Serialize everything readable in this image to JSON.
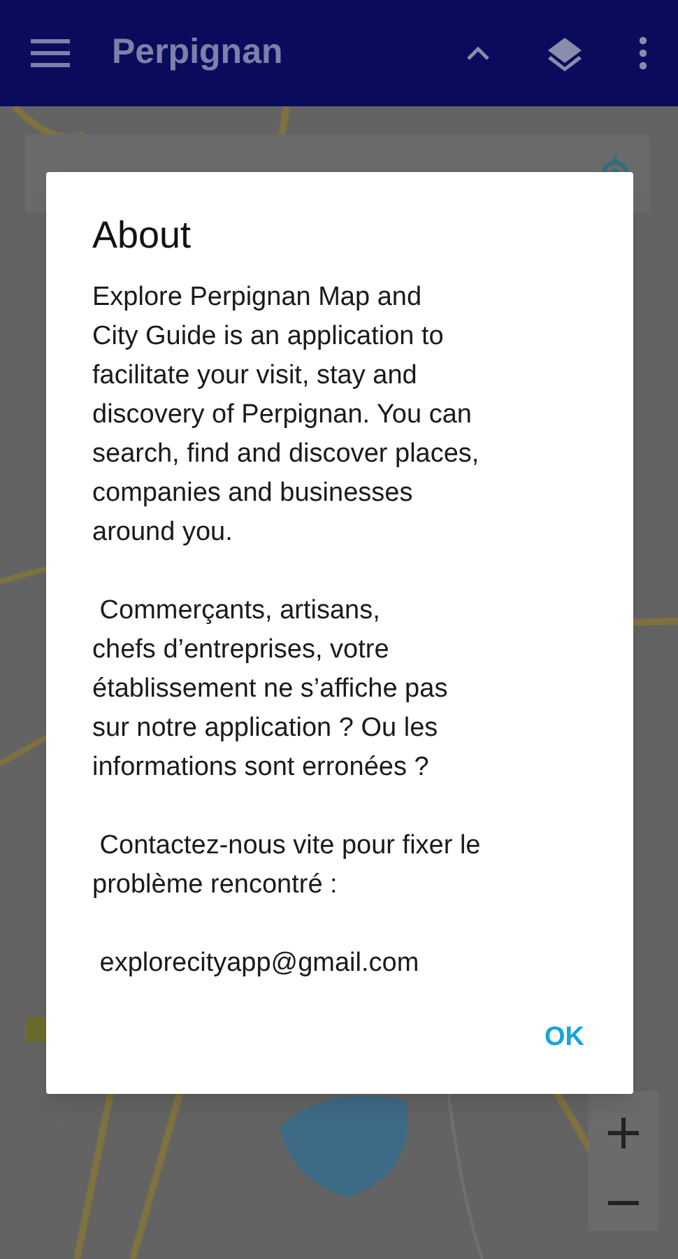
{
  "app_bar": {
    "title": "Perpignan"
  },
  "dialog": {
    "title": "About",
    "paragraphs": [
      "Explore Perpignan Map and\nCity Guide is an application to\nfacilitate your visit, stay and\ndiscovery of Perpignan. You can\nsearch, find and discover places,\ncompanies and businesses\naround you.",
      " Commerçants, artisans,\nchefs d’entreprises, votre\nétablissement ne s’affiche pas\nsur notre application ? Ou les\ninformations sont erronées ?",
      " Contactez-nous vite pour fixer le\nproblème rencontré :",
      " explorecityapp@gmail.com"
    ],
    "button": "OK"
  }
}
